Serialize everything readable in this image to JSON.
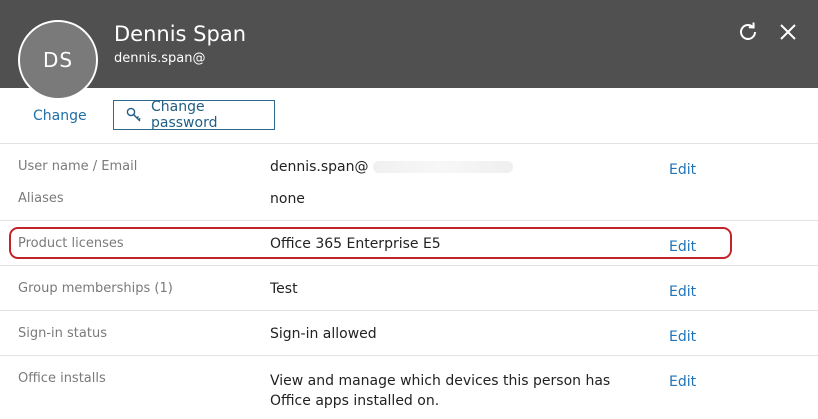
{
  "header": {
    "avatar_initials": "DS",
    "name": "Dennis Span",
    "email": "dennis.span@",
    "refresh_icon": "refresh-icon",
    "close_icon": "close-icon"
  },
  "actions": {
    "change_label": "Change",
    "change_password_label": "Change password",
    "key_icon": "key-icon"
  },
  "rows": [
    {
      "label": "User name / Email",
      "value": "dennis.span@",
      "edit": "Edit"
    },
    {
      "label": "Aliases",
      "value": "none"
    },
    {
      "label": "Product licenses",
      "value": "Office 365 Enterprise E5",
      "edit": "Edit"
    },
    {
      "label": "Group memberships (1)",
      "value": "Test",
      "edit": "Edit"
    },
    {
      "label": "Sign-in status",
      "value": "Sign-in allowed",
      "edit": "Edit"
    },
    {
      "label": "Office installs",
      "value_line1": "View and manage which devices this person has",
      "value_line2": "Office apps installed on.",
      "edit": "Edit"
    }
  ],
  "colors": {
    "header_bg": "#505050",
    "link": "#1f73b8",
    "highlight": "#c2242b"
  }
}
